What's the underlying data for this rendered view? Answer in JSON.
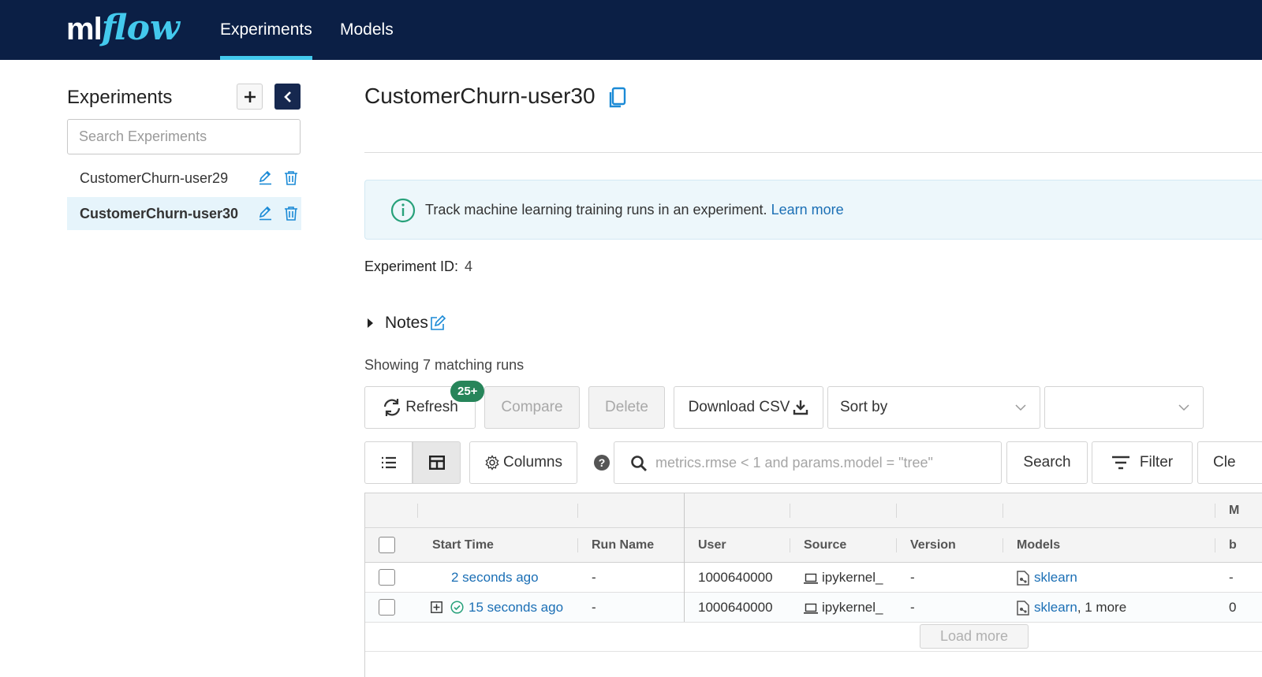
{
  "header": {
    "logo_ml": "ml",
    "logo_flow": "flow",
    "tabs": [
      {
        "label": "Experiments",
        "active": true
      },
      {
        "label": "Models",
        "active": false
      }
    ],
    "accent_color": "#43c9ed",
    "bg_color": "#0b1f45"
  },
  "sidebar": {
    "title": "Experiments",
    "add_icon": "plus-icon",
    "collapse_icon": "chevron-left-icon",
    "search_placeholder": "Search Experiments",
    "items": [
      {
        "label": "CustomerChurn-user29",
        "selected": false
      },
      {
        "label": "CustomerChurn-user30",
        "selected": true
      }
    ]
  },
  "main": {
    "title": "CustomerChurn-user30",
    "info_text": "Track machine learning training runs in an experiment.",
    "info_link": "Learn more",
    "experiment_id_label": "Experiment ID:",
    "experiment_id": "4",
    "notes_label": "Notes",
    "showing": "Showing 7 matching runs",
    "toolbar": {
      "refresh": "Refresh",
      "badge": "25+",
      "compare": "Compare",
      "delete": "Delete",
      "download": "Download CSV",
      "sort_by": "Sort by",
      "sort_second": ""
    },
    "searchbar": {
      "columns": "Columns",
      "help": "?",
      "query_placeholder": "metrics.rmse < 1 and params.model = \"tree\"",
      "search": "Search",
      "filter": "Filter",
      "clear": "Cle"
    },
    "table": {
      "group_headers": [
        "",
        "",
        "M"
      ],
      "columns": [
        "Start Time",
        "Run Name",
        "User",
        "Source",
        "Version",
        "Models",
        "b"
      ],
      "rows": [
        {
          "start_time": "2 seconds ago",
          "run_name": "-",
          "user": "1000640000",
          "source": "ipykernel_",
          "version": "-",
          "models": "sklearn",
          "models_more": "",
          "last": "-",
          "expandable": false,
          "status": ""
        },
        {
          "start_time": "15 seconds ago",
          "run_name": "-",
          "user": "1000640000",
          "source": "ipykernel_",
          "version": "-",
          "models": "sklearn",
          "models_more": ", 1 more",
          "last": "0",
          "expandable": true,
          "status": "finished"
        }
      ],
      "load_more": "Load more"
    }
  }
}
